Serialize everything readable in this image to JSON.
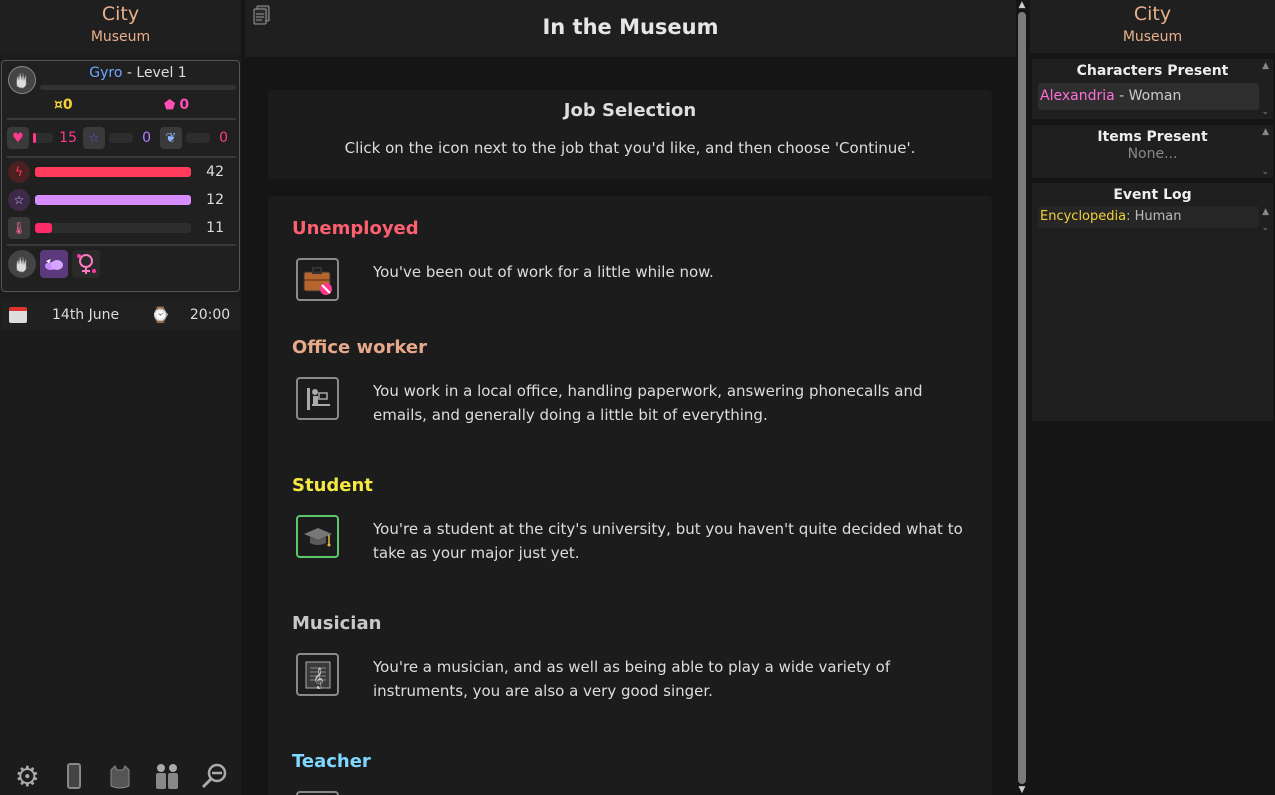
{
  "location": {
    "city": "City",
    "place": "Museum"
  },
  "player": {
    "name": "Gyro",
    "level_text": "- Level 1",
    "xp_fraction": 0.0,
    "money_text": "¤0",
    "essence_text": "0"
  },
  "mini_stats": [
    {
      "icon": "heart-icon",
      "value": "15",
      "color": "#ff3a8c",
      "fill": 0.08
    },
    {
      "icon": "star-icon",
      "value": "0",
      "color": "#b57bff",
      "fill": 0.0
    },
    {
      "icon": "wings-icon",
      "value": "0",
      "color": "#ff3a8c",
      "fill": 0.0
    }
  ],
  "bars": [
    {
      "icon": "lightning-icon",
      "value": "42",
      "color": "#ff3a5a",
      "fill": 1.0
    },
    {
      "icon": "pentagram-icon",
      "value": "12",
      "color": "#d88cff",
      "fill": 1.0
    },
    {
      "icon": "thermometer-icon",
      "value": "11",
      "color": "#ff2a6a",
      "fill": 0.11
    }
  ],
  "date": {
    "day": "14th June",
    "time": "20:00"
  },
  "center": {
    "title": "In the Museum",
    "job_selection_title": "Job Selection",
    "job_selection_hint": "Click on the icon next to the job that you'd like, and then choose 'Continue'."
  },
  "jobs": [
    {
      "name": "Unemployed",
      "color": "#ff5f6f",
      "icon": "briefcase-forbidden-icon",
      "desc": "You've been out of work for a little while now.",
      "border": "#8a8a8a"
    },
    {
      "name": "Office worker",
      "color": "#e8a88a",
      "icon": "office-desk-icon",
      "desc": "You work in a local office, handling paperwork, answering phonecalls and emails, and generally doing a little bit of everything.",
      "border": "#8a8a8a"
    },
    {
      "name": "Student",
      "color": "#f4e842",
      "icon": "graduation-cap-icon",
      "desc": "You're a student at the city's university, but you haven't quite decided what to take as your major just yet.",
      "border": "#5dc86a"
    },
    {
      "name": "Musician",
      "color": "#c8c8c8",
      "icon": "music-sheet-icon",
      "desc": "You're a musician, and as well as being able to play a wide variety of instruments, you are also a very good singer.",
      "border": "#8a8a8a"
    },
    {
      "name": "Teacher",
      "color": "#7fd8ff",
      "icon": "teacher-icon",
      "desc": "",
      "border": "#8a8a8a"
    }
  ],
  "right": {
    "characters_title": "Characters Present",
    "character_name": "Alexandria",
    "character_race": "- Woman",
    "items_title": "Items Present",
    "items_none": "None...",
    "event_title": "Event Log",
    "log_source": "Encyclopedia",
    "log_text": ": Human"
  }
}
